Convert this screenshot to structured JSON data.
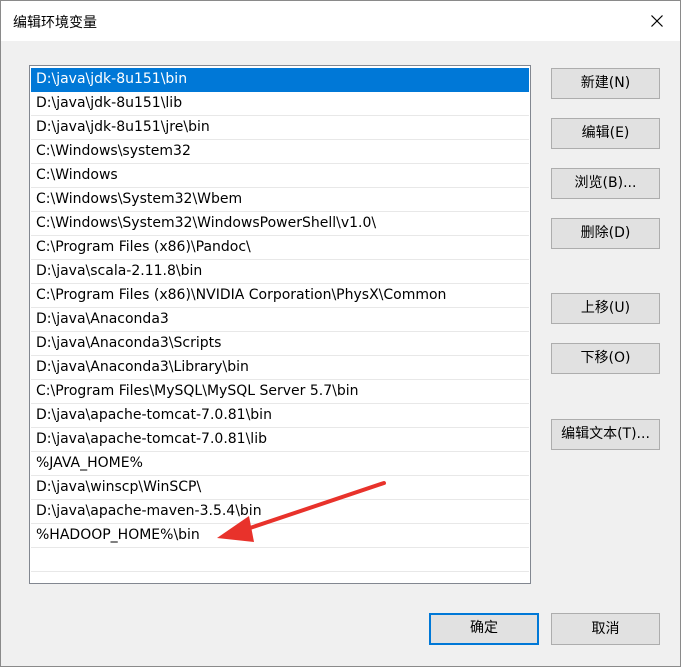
{
  "window": {
    "title": "编辑环境变量"
  },
  "path_list": {
    "items": [
      "D:\\java\\jdk-8u151\\bin",
      "D:\\java\\jdk-8u151\\lib",
      "D:\\java\\jdk-8u151\\jre\\bin",
      "C:\\Windows\\system32",
      "C:\\Windows",
      "C:\\Windows\\System32\\Wbem",
      "C:\\Windows\\System32\\WindowsPowerShell\\v1.0\\",
      "C:\\Program Files (x86)\\Pandoc\\",
      "D:\\java\\scala-2.11.8\\bin",
      "C:\\Program Files (x86)\\NVIDIA Corporation\\PhysX\\Common",
      "D:\\java\\Anaconda3",
      "D:\\java\\Anaconda3\\Scripts",
      "D:\\java\\Anaconda3\\Library\\bin",
      "C:\\Program Files\\MySQL\\MySQL Server 5.7\\bin",
      "D:\\java\\apache-tomcat-7.0.81\\bin",
      "D:\\java\\apache-tomcat-7.0.81\\lib",
      "%JAVA_HOME%",
      "D:\\java\\winscp\\WinSCP\\",
      "D:\\java\\apache-maven-3.5.4\\bin",
      "%HADOOP_HOME%\\bin"
    ],
    "selected_index": 0
  },
  "buttons": {
    "new": "新建(N)",
    "edit": "编辑(E)",
    "browse": "浏览(B)...",
    "delete": "删除(D)",
    "move_up": "上移(U)",
    "move_down": "下移(O)",
    "edit_text": "编辑文本(T)...",
    "ok": "确定",
    "cancel": "取消"
  },
  "colors": {
    "selection": "#0078d7",
    "annotation_arrow": "#e8322b"
  },
  "icons": {
    "close": "close-icon",
    "annotation": "red-arrow-annotation"
  }
}
